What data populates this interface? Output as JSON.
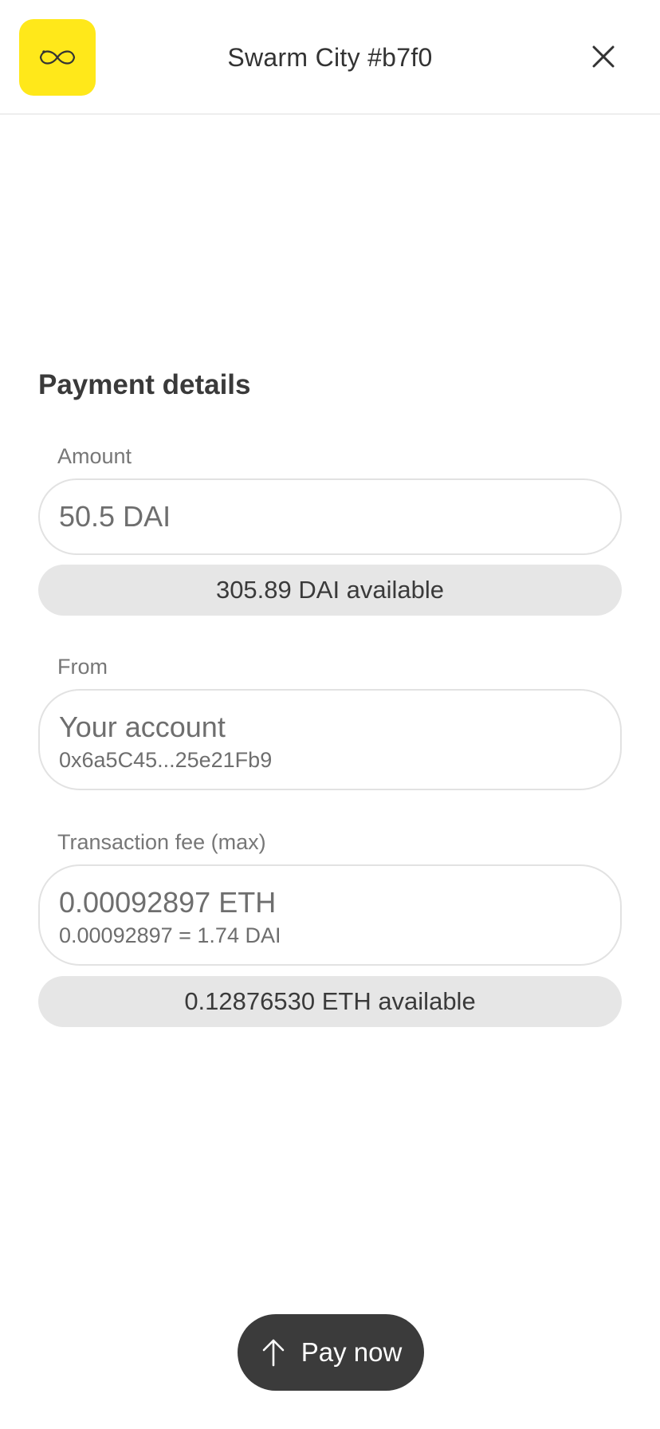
{
  "header": {
    "title": "Swarm City #b7f0",
    "logo_icon": "infinity-icon",
    "close_icon": "close-icon",
    "logo_color": "#ffe81a"
  },
  "payment": {
    "section_title": "Payment details",
    "amount": {
      "label": "Amount",
      "value": "50.5 DAI",
      "available": "305.89 DAI available"
    },
    "from": {
      "label": "From",
      "account_name": "Your account",
      "address": "0x6a5C45...25e21Fb9"
    },
    "fee": {
      "label": "Transaction fee (max)",
      "value": "0.00092897 ETH",
      "conversion": "0.00092897 = 1.74 DAI",
      "available": "0.12876530 ETH available"
    }
  },
  "actions": {
    "pay_label": "Pay now",
    "pay_icon": "arrow-up-icon",
    "pay_color": "#3b3b3b"
  }
}
